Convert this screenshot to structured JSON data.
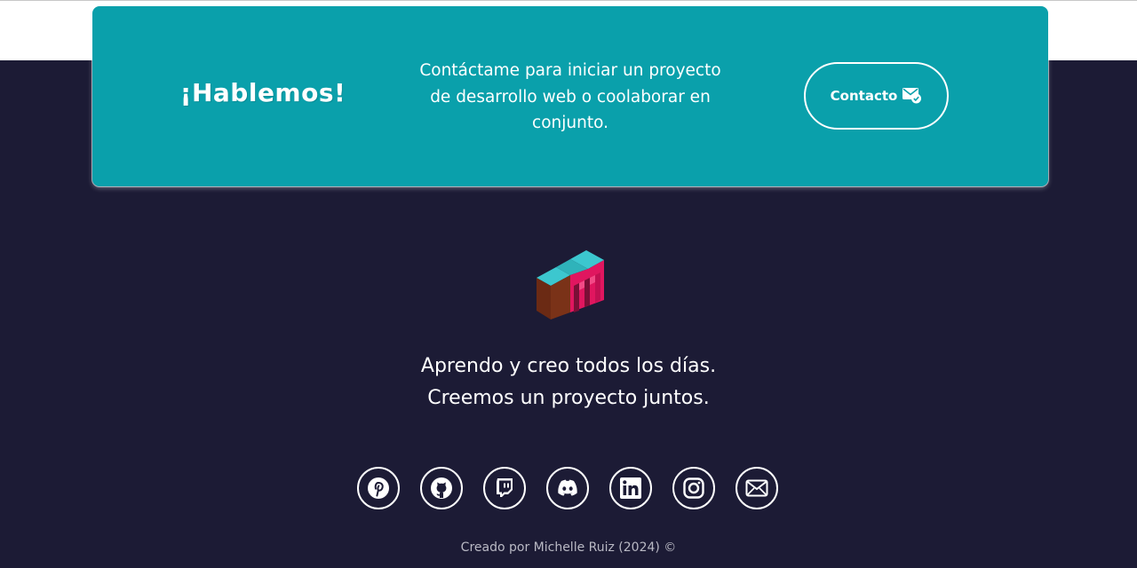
{
  "cta": {
    "title": "¡Hablemos!",
    "text": "Contáctame para iniciar un proyecto de desarrollo web o coolaborar en conjunto.",
    "button_label": "Contacto",
    "button_icon": "mail-check-icon",
    "background": "#0aa0ab"
  },
  "tagline": {
    "line1": "Aprendo y creo todos los días.",
    "line2": "Creemos un proyecto juntos."
  },
  "socials": [
    {
      "name": "pinterest",
      "icon": "pinterest-icon"
    },
    {
      "name": "github",
      "icon": "github-icon"
    },
    {
      "name": "twitch",
      "icon": "twitch-icon"
    },
    {
      "name": "discord",
      "icon": "discord-icon"
    },
    {
      "name": "linkedin",
      "icon": "linkedin-icon"
    },
    {
      "name": "instagram",
      "icon": "instagram-icon"
    },
    {
      "name": "email",
      "icon": "envelope-icon"
    }
  ],
  "footer": {
    "credit": "Creado por Michelle Ruiz (2024) ©"
  },
  "colors": {
    "page_background": "#1c1b35",
    "accent_teal": "#0aa0ab",
    "logo_pink": "#e0165f",
    "logo_brown": "#6b2a14",
    "logo_cyan": "#3cc7cf"
  }
}
